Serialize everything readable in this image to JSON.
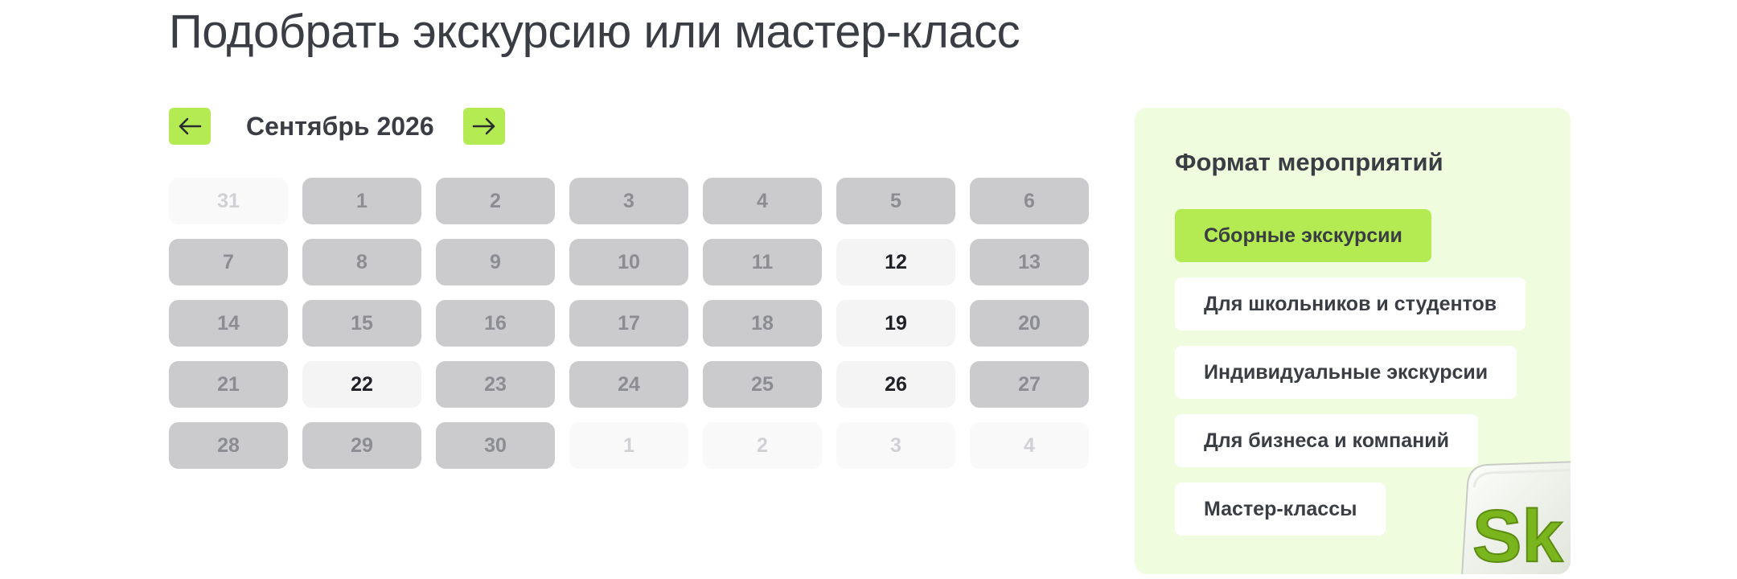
{
  "page_title": "Подобрать экскурсию или мастер-класс",
  "calendar": {
    "month_label": "Сентябрь 2026",
    "prev_icon": "arrow-left-icon",
    "next_icon": "arrow-right-icon",
    "rows": [
      [
        {
          "day": "31",
          "state": "other"
        },
        {
          "day": "1",
          "state": "busy"
        },
        {
          "day": "2",
          "state": "busy"
        },
        {
          "day": "3",
          "state": "busy"
        },
        {
          "day": "4",
          "state": "busy"
        },
        {
          "day": "5",
          "state": "busy"
        },
        {
          "day": "6",
          "state": "busy"
        }
      ],
      [
        {
          "day": "7",
          "state": "busy"
        },
        {
          "day": "8",
          "state": "busy"
        },
        {
          "day": "9",
          "state": "busy"
        },
        {
          "day": "10",
          "state": "busy"
        },
        {
          "day": "11",
          "state": "busy"
        },
        {
          "day": "12",
          "state": "free"
        },
        {
          "day": "13",
          "state": "busy"
        }
      ],
      [
        {
          "day": "14",
          "state": "busy"
        },
        {
          "day": "15",
          "state": "busy"
        },
        {
          "day": "16",
          "state": "busy"
        },
        {
          "day": "17",
          "state": "busy"
        },
        {
          "day": "18",
          "state": "busy"
        },
        {
          "day": "19",
          "state": "free"
        },
        {
          "day": "20",
          "state": "busy"
        }
      ],
      [
        {
          "day": "21",
          "state": "busy"
        },
        {
          "day": "22",
          "state": "free"
        },
        {
          "day": "23",
          "state": "busy"
        },
        {
          "day": "24",
          "state": "busy"
        },
        {
          "day": "25",
          "state": "busy"
        },
        {
          "day": "26",
          "state": "free"
        },
        {
          "day": "27",
          "state": "busy"
        }
      ],
      [
        {
          "day": "28",
          "state": "busy"
        },
        {
          "day": "29",
          "state": "busy"
        },
        {
          "day": "30",
          "state": "busy"
        },
        {
          "day": "1",
          "state": "other"
        },
        {
          "day": "2",
          "state": "other"
        },
        {
          "day": "3",
          "state": "other"
        },
        {
          "day": "4",
          "state": "other"
        }
      ]
    ]
  },
  "formats": {
    "title": "Формат мероприятий",
    "items": [
      {
        "label": "Сборные экскурсии",
        "active": true
      },
      {
        "label": "Для школьников и студентов",
        "active": false
      },
      {
        "label": "Индивидуальные экскурсии",
        "active": false
      },
      {
        "label": "Для бизнеса и компаний",
        "active": false
      },
      {
        "label": "Мастер-классы",
        "active": false
      }
    ],
    "logo_text": "Sk",
    "logo_icon": "skolkovo-logo-icon"
  },
  "colors": {
    "accent": "#b4eb52",
    "panel_bg": "#effcde",
    "busy_day_bg": "#cbcbcd",
    "free_day_bg": "#f4f4f5",
    "text": "#3a3d44"
  }
}
